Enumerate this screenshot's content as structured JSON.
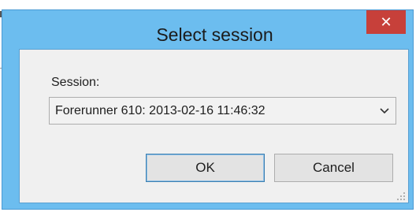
{
  "window": {
    "title": "Select session",
    "close_icon": "close-icon",
    "title_color": "#6cbdef",
    "close_color": "#c7403a"
  },
  "form": {
    "session_label": "Session:",
    "session_value": "Forerunner 610: 2013-02-16 11:46:32",
    "dropdown_icon": "chevron-down-icon"
  },
  "buttons": {
    "ok_label": "OK",
    "cancel_label": "Cancel"
  },
  "icons": {
    "resize_grip": "resize-grip-icon"
  }
}
